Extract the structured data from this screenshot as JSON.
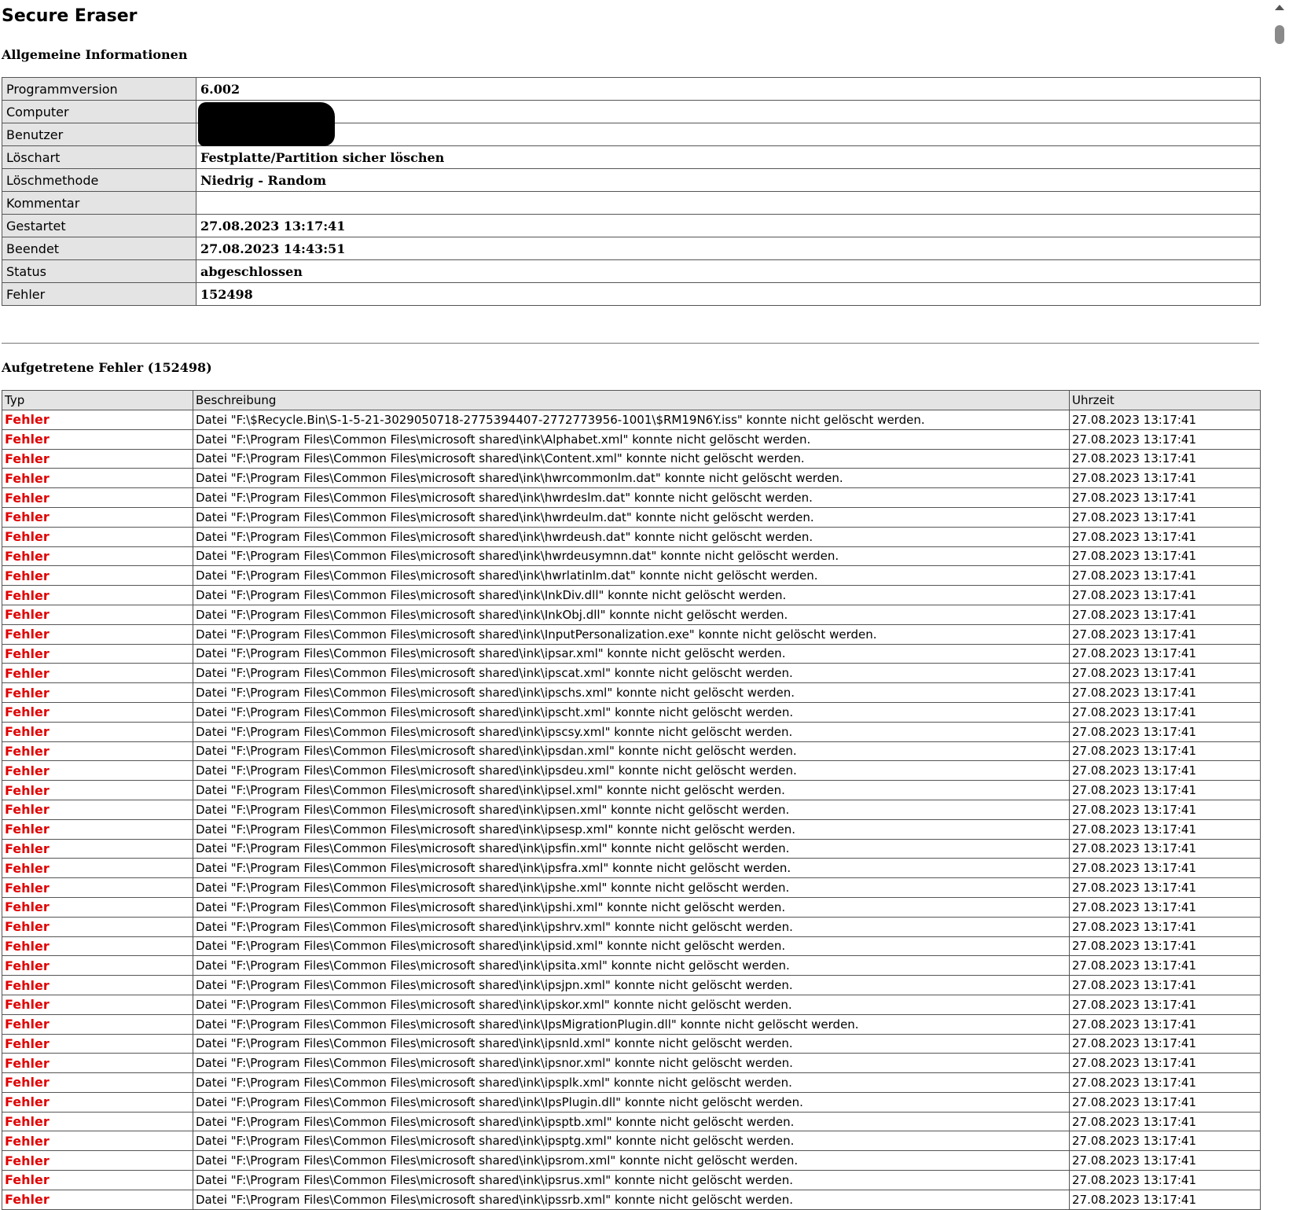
{
  "title": "Secure Eraser",
  "general": {
    "heading": "Allgemeine Informationen",
    "rows": [
      {
        "label": "Programmversion",
        "value": "6.002"
      },
      {
        "label": "Computer",
        "value": ""
      },
      {
        "label": "Benutzer",
        "value": ""
      },
      {
        "label": "Löschart",
        "value": "Festplatte/Partition sicher löschen"
      },
      {
        "label": "Löschmethode",
        "value": "Niedrig - Random"
      },
      {
        "label": "Kommentar",
        "value": ""
      },
      {
        "label": "Gestartet",
        "value": "27.08.2023 13:17:41"
      },
      {
        "label": "Beendet",
        "value": "27.08.2023 14:43:51"
      },
      {
        "label": "Status",
        "value": "abgeschlossen"
      },
      {
        "label": "Fehler",
        "value": "152498"
      }
    ]
  },
  "errors": {
    "heading": "Aufgetretene Fehler (152498)",
    "columns": [
      "Typ",
      "Beschreibung",
      "Uhrzeit"
    ],
    "rows": [
      {
        "typ": "Fehler",
        "desc": "Datei \"F:\\$Recycle.Bin\\S-1-5-21-3029050718-2775394407-2772773956-1001\\$RM19N6Y.iss\" konnte nicht gelöscht werden.",
        "time": "27.08.2023 13:17:41"
      },
      {
        "typ": "Fehler",
        "desc": "Datei \"F:\\Program Files\\Common Files\\microsoft shared\\ink\\Alphabet.xml\" konnte nicht gelöscht werden.",
        "time": "27.08.2023 13:17:41"
      },
      {
        "typ": "Fehler",
        "desc": "Datei \"F:\\Program Files\\Common Files\\microsoft shared\\ink\\Content.xml\" konnte nicht gelöscht werden.",
        "time": "27.08.2023 13:17:41"
      },
      {
        "typ": "Fehler",
        "desc": "Datei \"F:\\Program Files\\Common Files\\microsoft shared\\ink\\hwrcommonlm.dat\" konnte nicht gelöscht werden.",
        "time": "27.08.2023 13:17:41"
      },
      {
        "typ": "Fehler",
        "desc": "Datei \"F:\\Program Files\\Common Files\\microsoft shared\\ink\\hwrdeslm.dat\" konnte nicht gelöscht werden.",
        "time": "27.08.2023 13:17:41"
      },
      {
        "typ": "Fehler",
        "desc": "Datei \"F:\\Program Files\\Common Files\\microsoft shared\\ink\\hwrdeulm.dat\" konnte nicht gelöscht werden.",
        "time": "27.08.2023 13:17:41"
      },
      {
        "typ": "Fehler",
        "desc": "Datei \"F:\\Program Files\\Common Files\\microsoft shared\\ink\\hwrdeush.dat\" konnte nicht gelöscht werden.",
        "time": "27.08.2023 13:17:41"
      },
      {
        "typ": "Fehler",
        "desc": "Datei \"F:\\Program Files\\Common Files\\microsoft shared\\ink\\hwrdeusymnn.dat\" konnte nicht gelöscht werden.",
        "time": "27.08.2023 13:17:41"
      },
      {
        "typ": "Fehler",
        "desc": "Datei \"F:\\Program Files\\Common Files\\microsoft shared\\ink\\hwrlatinlm.dat\" konnte nicht gelöscht werden.",
        "time": "27.08.2023 13:17:41"
      },
      {
        "typ": "Fehler",
        "desc": "Datei \"F:\\Program Files\\Common Files\\microsoft shared\\ink\\InkDiv.dll\" konnte nicht gelöscht werden.",
        "time": "27.08.2023 13:17:41"
      },
      {
        "typ": "Fehler",
        "desc": "Datei \"F:\\Program Files\\Common Files\\microsoft shared\\ink\\InkObj.dll\" konnte nicht gelöscht werden.",
        "time": "27.08.2023 13:17:41"
      },
      {
        "typ": "Fehler",
        "desc": "Datei \"F:\\Program Files\\Common Files\\microsoft shared\\ink\\InputPersonalization.exe\" konnte nicht gelöscht werden.",
        "time": "27.08.2023 13:17:41"
      },
      {
        "typ": "Fehler",
        "desc": "Datei \"F:\\Program Files\\Common Files\\microsoft shared\\ink\\ipsar.xml\" konnte nicht gelöscht werden.",
        "time": "27.08.2023 13:17:41"
      },
      {
        "typ": "Fehler",
        "desc": "Datei \"F:\\Program Files\\Common Files\\microsoft shared\\ink\\ipscat.xml\" konnte nicht gelöscht werden.",
        "time": "27.08.2023 13:17:41"
      },
      {
        "typ": "Fehler",
        "desc": "Datei \"F:\\Program Files\\Common Files\\microsoft shared\\ink\\ipschs.xml\" konnte nicht gelöscht werden.",
        "time": "27.08.2023 13:17:41"
      },
      {
        "typ": "Fehler",
        "desc": "Datei \"F:\\Program Files\\Common Files\\microsoft shared\\ink\\ipscht.xml\" konnte nicht gelöscht werden.",
        "time": "27.08.2023 13:17:41"
      },
      {
        "typ": "Fehler",
        "desc": "Datei \"F:\\Program Files\\Common Files\\microsoft shared\\ink\\ipscsy.xml\" konnte nicht gelöscht werden.",
        "time": "27.08.2023 13:17:41"
      },
      {
        "typ": "Fehler",
        "desc": "Datei \"F:\\Program Files\\Common Files\\microsoft shared\\ink\\ipsdan.xml\" konnte nicht gelöscht werden.",
        "time": "27.08.2023 13:17:41"
      },
      {
        "typ": "Fehler",
        "desc": "Datei \"F:\\Program Files\\Common Files\\microsoft shared\\ink\\ipsdeu.xml\" konnte nicht gelöscht werden.",
        "time": "27.08.2023 13:17:41"
      },
      {
        "typ": "Fehler",
        "desc": "Datei \"F:\\Program Files\\Common Files\\microsoft shared\\ink\\ipsel.xml\" konnte nicht gelöscht werden.",
        "time": "27.08.2023 13:17:41"
      },
      {
        "typ": "Fehler",
        "desc": "Datei \"F:\\Program Files\\Common Files\\microsoft shared\\ink\\ipsen.xml\" konnte nicht gelöscht werden.",
        "time": "27.08.2023 13:17:41"
      },
      {
        "typ": "Fehler",
        "desc": "Datei \"F:\\Program Files\\Common Files\\microsoft shared\\ink\\ipsesp.xml\" konnte nicht gelöscht werden.",
        "time": "27.08.2023 13:17:41"
      },
      {
        "typ": "Fehler",
        "desc": "Datei \"F:\\Program Files\\Common Files\\microsoft shared\\ink\\ipsfin.xml\" konnte nicht gelöscht werden.",
        "time": "27.08.2023 13:17:41"
      },
      {
        "typ": "Fehler",
        "desc": "Datei \"F:\\Program Files\\Common Files\\microsoft shared\\ink\\ipsfra.xml\" konnte nicht gelöscht werden.",
        "time": "27.08.2023 13:17:41"
      },
      {
        "typ": "Fehler",
        "desc": "Datei \"F:\\Program Files\\Common Files\\microsoft shared\\ink\\ipshe.xml\" konnte nicht gelöscht werden.",
        "time": "27.08.2023 13:17:41"
      },
      {
        "typ": "Fehler",
        "desc": "Datei \"F:\\Program Files\\Common Files\\microsoft shared\\ink\\ipshi.xml\" konnte nicht gelöscht werden.",
        "time": "27.08.2023 13:17:41"
      },
      {
        "typ": "Fehler",
        "desc": "Datei \"F:\\Program Files\\Common Files\\microsoft shared\\ink\\ipshrv.xml\" konnte nicht gelöscht werden.",
        "time": "27.08.2023 13:17:41"
      },
      {
        "typ": "Fehler",
        "desc": "Datei \"F:\\Program Files\\Common Files\\microsoft shared\\ink\\ipsid.xml\" konnte nicht gelöscht werden.",
        "time": "27.08.2023 13:17:41"
      },
      {
        "typ": "Fehler",
        "desc": "Datei \"F:\\Program Files\\Common Files\\microsoft shared\\ink\\ipsita.xml\" konnte nicht gelöscht werden.",
        "time": "27.08.2023 13:17:41"
      },
      {
        "typ": "Fehler",
        "desc": "Datei \"F:\\Program Files\\Common Files\\microsoft shared\\ink\\ipsjpn.xml\" konnte nicht gelöscht werden.",
        "time": "27.08.2023 13:17:41"
      },
      {
        "typ": "Fehler",
        "desc": "Datei \"F:\\Program Files\\Common Files\\microsoft shared\\ink\\ipskor.xml\" konnte nicht gelöscht werden.",
        "time": "27.08.2023 13:17:41"
      },
      {
        "typ": "Fehler",
        "desc": "Datei \"F:\\Program Files\\Common Files\\microsoft shared\\ink\\IpsMigrationPlugin.dll\" konnte nicht gelöscht werden.",
        "time": "27.08.2023 13:17:41"
      },
      {
        "typ": "Fehler",
        "desc": "Datei \"F:\\Program Files\\Common Files\\microsoft shared\\ink\\ipsnld.xml\" konnte nicht gelöscht werden.",
        "time": "27.08.2023 13:17:41"
      },
      {
        "typ": "Fehler",
        "desc": "Datei \"F:\\Program Files\\Common Files\\microsoft shared\\ink\\ipsnor.xml\" konnte nicht gelöscht werden.",
        "time": "27.08.2023 13:17:41"
      },
      {
        "typ": "Fehler",
        "desc": "Datei \"F:\\Program Files\\Common Files\\microsoft shared\\ink\\ipsplk.xml\" konnte nicht gelöscht werden.",
        "time": "27.08.2023 13:17:41"
      },
      {
        "typ": "Fehler",
        "desc": "Datei \"F:\\Program Files\\Common Files\\microsoft shared\\ink\\IpsPlugin.dll\" konnte nicht gelöscht werden.",
        "time": "27.08.2023 13:17:41"
      },
      {
        "typ": "Fehler",
        "desc": "Datei \"F:\\Program Files\\Common Files\\microsoft shared\\ink\\ipsptb.xml\" konnte nicht gelöscht werden.",
        "time": "27.08.2023 13:17:41"
      },
      {
        "typ": "Fehler",
        "desc": "Datei \"F:\\Program Files\\Common Files\\microsoft shared\\ink\\ipsptg.xml\" konnte nicht gelöscht werden.",
        "time": "27.08.2023 13:17:41"
      },
      {
        "typ": "Fehler",
        "desc": "Datei \"F:\\Program Files\\Common Files\\microsoft shared\\ink\\ipsrom.xml\" konnte nicht gelöscht werden.",
        "time": "27.08.2023 13:17:41"
      },
      {
        "typ": "Fehler",
        "desc": "Datei \"F:\\Program Files\\Common Files\\microsoft shared\\ink\\ipsrus.xml\" konnte nicht gelöscht werden.",
        "time": "27.08.2023 13:17:41"
      },
      {
        "typ": "Fehler",
        "desc": "Datei \"F:\\Program Files\\Common Files\\microsoft shared\\ink\\ipssrb.xml\" konnte nicht gelöscht werden.",
        "time": "27.08.2023 13:17:41"
      }
    ]
  },
  "scrollbar": {
    "up_icon": "chevron-up-icon"
  },
  "colors": {
    "error_type": "#e00000",
    "label_bg": "#e4e4e4"
  }
}
